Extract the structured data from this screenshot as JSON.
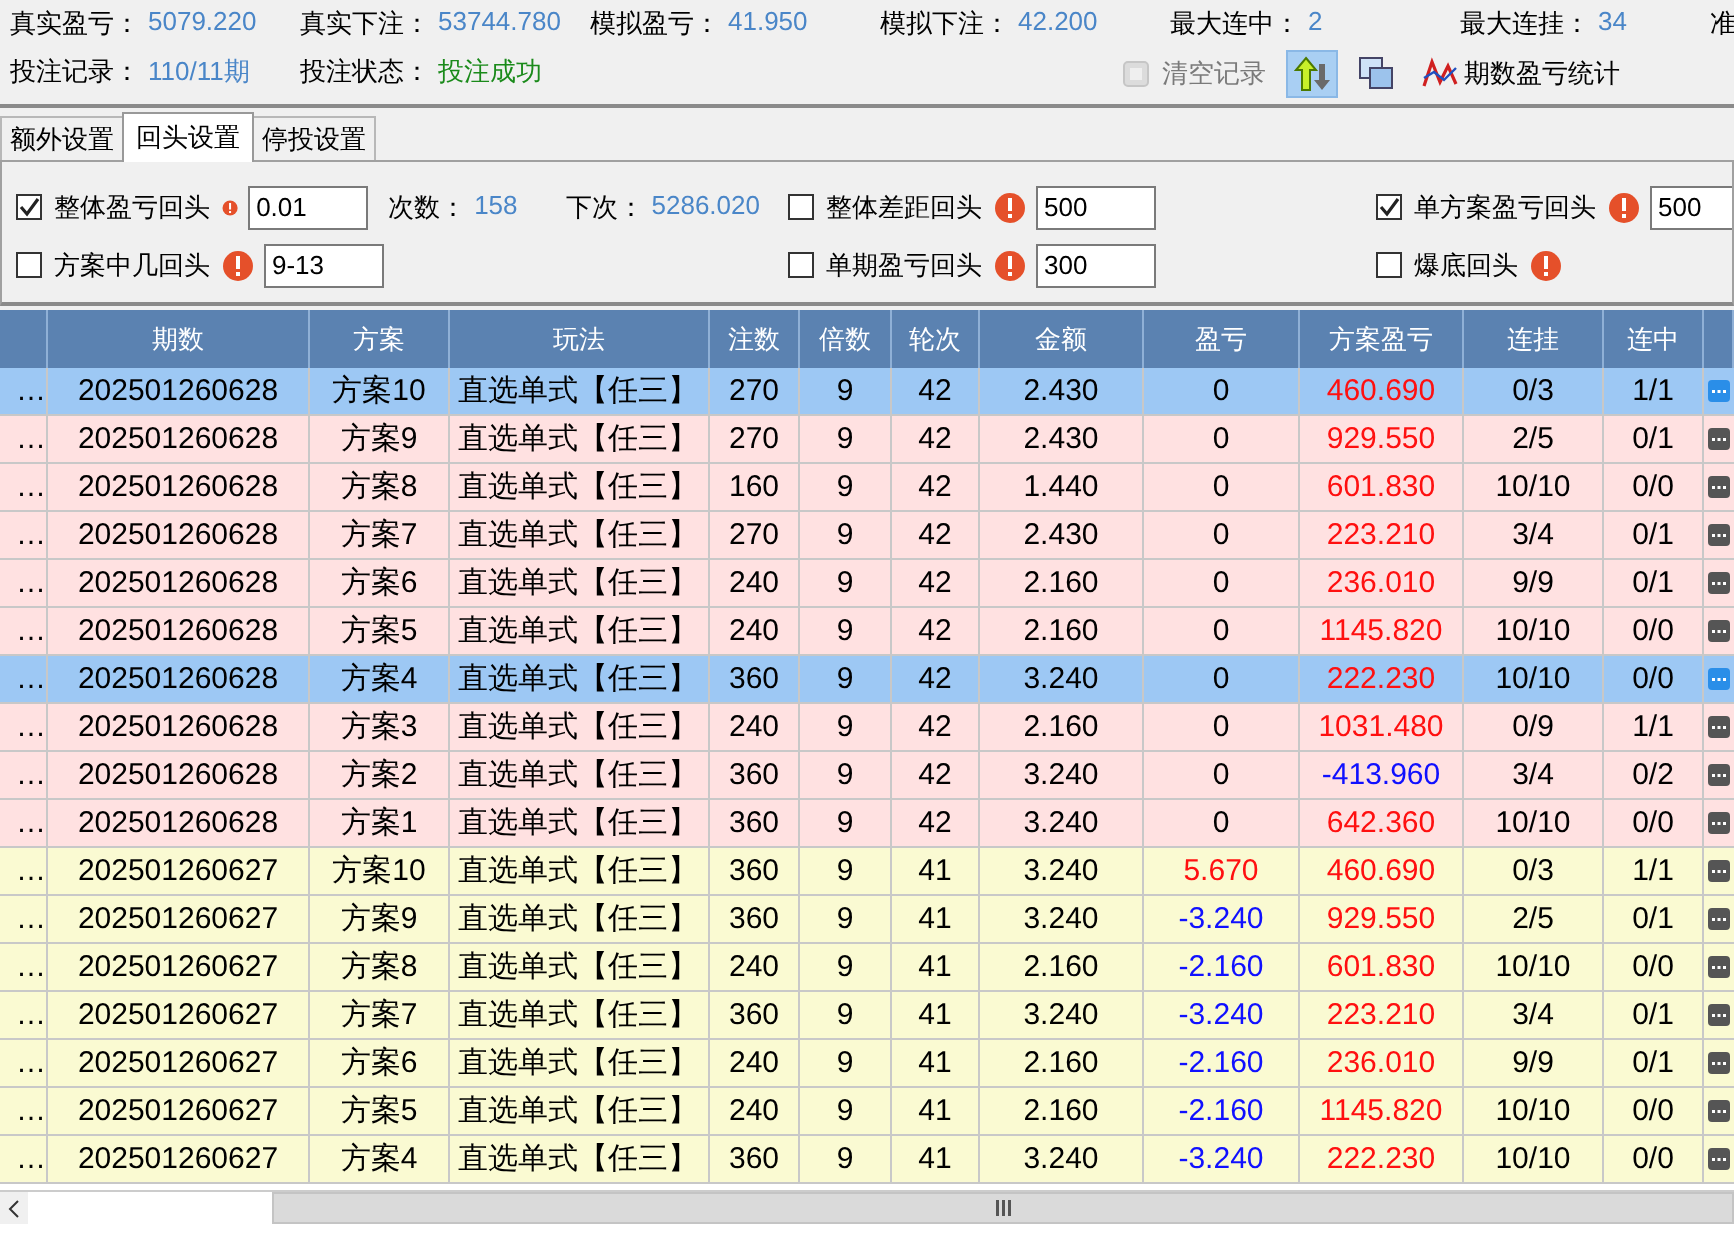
{
  "stats": [
    [
      {
        "label": "真实盈亏：",
        "value": "5079.220",
        "color": "#4a86c8"
      },
      {
        "label": "真实下注：",
        "value": "53744.780",
        "color": "#4a86c8"
      },
      {
        "label": "模拟盈亏：",
        "value": "41.950",
        "color": "#4a86c8"
      },
      {
        "label": "模拟下注：",
        "value": "42.200",
        "color": "#4a86c8"
      },
      {
        "label": "最大连中：",
        "value": "2",
        "color": "#4a86c8"
      },
      {
        "label": "最大连挂：",
        "value": "34",
        "color": "#4a86c8"
      },
      {
        "label": "准"
      }
    ],
    [
      {
        "label": "投注记录：",
        "value": "110/11期",
        "color": "#4a86c8"
      },
      {
        "label": "投注状态：",
        "value": "投注成功",
        "color": "#1a8a1a"
      }
    ]
  ],
  "toolbar": [
    {
      "label": "清空记录",
      "disabled": true,
      "selected": false
    },
    {
      "disabled": false,
      "selected": true
    },
    {
      "disabled": false,
      "selected": false
    },
    {
      "label": "期数盈亏统计",
      "disabled": false,
      "selected": false
    }
  ],
  "tabs": [
    {
      "label": "额外设置",
      "selected": false
    },
    {
      "label": "回头设置",
      "selected": true
    },
    {
      "label": "停投设置",
      "selected": false
    }
  ],
  "settings": [
    [
      [
        {
          "kind": "option",
          "label": "整体盈亏回头",
          "checked": true,
          "value": "0.01"
        },
        {
          "kind": "readout",
          "label": "次数：",
          "value": "158"
        },
        {
          "kind": "readout",
          "label": "下次：",
          "value": "5286.020"
        }
      ],
      [
        {
          "kind": "option",
          "label": "整体差距回头",
          "checked": false,
          "value": "500"
        }
      ],
      [
        {
          "kind": "option",
          "label": "单方案盈亏回头",
          "checked": true,
          "value": "500"
        }
      ]
    ],
    [
      [
        {
          "kind": "option",
          "label": "方案中几回头",
          "checked": false,
          "value": "9-13"
        }
      ],
      [
        {
          "kind": "option",
          "label": "单期盈亏回头",
          "checked": false,
          "value": "300"
        }
      ],
      [
        {
          "kind": "option",
          "label": "爆底回头",
          "checked": false
        }
      ]
    ]
  ],
  "table": {
    "columns": [
      "",
      "期数",
      "方案",
      "玩法",
      "注数",
      "倍数",
      "轮次",
      "金额",
      "盈亏",
      "方案盈亏",
      "连挂",
      "连中"
    ],
    "rows": [
      {
        "selected": true,
        "color": "#9dc8f4",
        "cells": [
          "…",
          "202501260628",
          "方案10",
          "直选单式【任三】",
          "270",
          "9",
          "42",
          "2.430",
          {
            "text": "0",
            "color": "#000000"
          },
          {
            "text": "460.690",
            "color": "#ff1010"
          },
          "0/3",
          "1/1"
        ]
      },
      {
        "selected": false,
        "color": "#ffe1e1",
        "cells": [
          "…",
          "202501260628",
          "方案9",
          "直选单式【任三】",
          "270",
          "9",
          "42",
          "2.430",
          {
            "text": "0",
            "color": "#000000"
          },
          {
            "text": "929.550",
            "color": "#ff1010"
          },
          "2/5",
          "0/1"
        ]
      },
      {
        "selected": false,
        "color": "#ffe1e1",
        "cells": [
          "…",
          "202501260628",
          "方案8",
          "直选单式【任三】",
          "160",
          "9",
          "42",
          "1.440",
          {
            "text": "0",
            "color": "#000000"
          },
          {
            "text": "601.830",
            "color": "#ff1010"
          },
          "10/10",
          "0/0"
        ]
      },
      {
        "selected": false,
        "color": "#ffe1e1",
        "cells": [
          "…",
          "202501260628",
          "方案7",
          "直选单式【任三】",
          "270",
          "9",
          "42",
          "2.430",
          {
            "text": "0",
            "color": "#000000"
          },
          {
            "text": "223.210",
            "color": "#ff1010"
          },
          "3/4",
          "0/1"
        ]
      },
      {
        "selected": false,
        "color": "#ffe1e1",
        "cells": [
          "…",
          "202501260628",
          "方案6",
          "直选单式【任三】",
          "240",
          "9",
          "42",
          "2.160",
          {
            "text": "0",
            "color": "#000000"
          },
          {
            "text": "236.010",
            "color": "#ff1010"
          },
          "9/9",
          "0/1"
        ]
      },
      {
        "selected": false,
        "color": "#ffe1e1",
        "cells": [
          "…",
          "202501260628",
          "方案5",
          "直选单式【任三】",
          "240",
          "9",
          "42",
          "2.160",
          {
            "text": "0",
            "color": "#000000"
          },
          {
            "text": "1145.820",
            "color": "#ff1010"
          },
          "10/10",
          "0/0"
        ]
      },
      {
        "selected": true,
        "color": "#9dc8f4",
        "cells": [
          "…",
          "202501260628",
          "方案4",
          "直选单式【任三】",
          "360",
          "9",
          "42",
          "3.240",
          {
            "text": "0",
            "color": "#000000"
          },
          {
            "text": "222.230",
            "color": "#ff1010"
          },
          "10/10",
          "0/0"
        ]
      },
      {
        "selected": false,
        "color": "#ffe1e1",
        "cells": [
          "…",
          "202501260628",
          "方案3",
          "直选单式【任三】",
          "240",
          "9",
          "42",
          "2.160",
          {
            "text": "0",
            "color": "#000000"
          },
          {
            "text": "1031.480",
            "color": "#ff1010"
          },
          "0/9",
          "1/1"
        ]
      },
      {
        "selected": false,
        "color": "#ffe1e1",
        "cells": [
          "…",
          "202501260628",
          "方案2",
          "直选单式【任三】",
          "360",
          "9",
          "42",
          "3.240",
          {
            "text": "0",
            "color": "#000000"
          },
          {
            "text": "-413.960",
            "color": "#1010ff"
          },
          "3/4",
          "0/2"
        ]
      },
      {
        "selected": false,
        "color": "#ffe1e1",
        "cells": [
          "…",
          "202501260628",
          "方案1",
          "直选单式【任三】",
          "360",
          "9",
          "42",
          "3.240",
          {
            "text": "0",
            "color": "#000000"
          },
          {
            "text": "642.360",
            "color": "#ff1010"
          },
          "10/10",
          "0/0"
        ]
      },
      {
        "selected": false,
        "color": "#fafad2",
        "cells": [
          "…",
          "202501260627",
          "方案10",
          "直选单式【任三】",
          "360",
          "9",
          "41",
          "3.240",
          {
            "text": "5.670",
            "color": "#ff1010"
          },
          {
            "text": "460.690",
            "color": "#ff1010"
          },
          "0/3",
          "1/1"
        ]
      },
      {
        "selected": false,
        "color": "#fafad2",
        "cells": [
          "…",
          "202501260627",
          "方案9",
          "直选单式【任三】",
          "360",
          "9",
          "41",
          "3.240",
          {
            "text": "-3.240",
            "color": "#1010ff"
          },
          {
            "text": "929.550",
            "color": "#ff1010"
          },
          "2/5",
          "0/1"
        ]
      },
      {
        "selected": false,
        "color": "#fafad2",
        "cells": [
          "…",
          "202501260627",
          "方案8",
          "直选单式【任三】",
          "240",
          "9",
          "41",
          "2.160",
          {
            "text": "-2.160",
            "color": "#1010ff"
          },
          {
            "text": "601.830",
            "color": "#ff1010"
          },
          "10/10",
          "0/0"
        ]
      },
      {
        "selected": false,
        "color": "#fafad2",
        "cells": [
          "…",
          "202501260627",
          "方案7",
          "直选单式【任三】",
          "360",
          "9",
          "41",
          "3.240",
          {
            "text": "-3.240",
            "color": "#1010ff"
          },
          {
            "text": "223.210",
            "color": "#ff1010"
          },
          "3/4",
          "0/1"
        ]
      },
      {
        "selected": false,
        "color": "#fafad2",
        "cells": [
          "…",
          "202501260627",
          "方案6",
          "直选单式【任三】",
          "240",
          "9",
          "41",
          "2.160",
          {
            "text": "-2.160",
            "color": "#1010ff"
          },
          {
            "text": "236.010",
            "color": "#ff1010"
          },
          "9/9",
          "0/1"
        ]
      },
      {
        "selected": false,
        "color": "#fafad2",
        "cells": [
          "…",
          "202501260627",
          "方案5",
          "直选单式【任三】",
          "240",
          "9",
          "41",
          "2.160",
          {
            "text": "-2.160",
            "color": "#1010ff"
          },
          {
            "text": "1145.820",
            "color": "#ff1010"
          },
          "10/10",
          "0/0"
        ]
      },
      {
        "selected": false,
        "color": "#fafad2",
        "cells": [
          "…",
          "202501260627",
          "方案4",
          "直选单式【任三】",
          "360",
          "9",
          "41",
          "3.240",
          {
            "text": "-3.240",
            "color": "#1010ff"
          },
          {
            "text": "222.230",
            "color": "#ff1010"
          },
          "10/10",
          "0/0"
        ]
      }
    ]
  }
}
